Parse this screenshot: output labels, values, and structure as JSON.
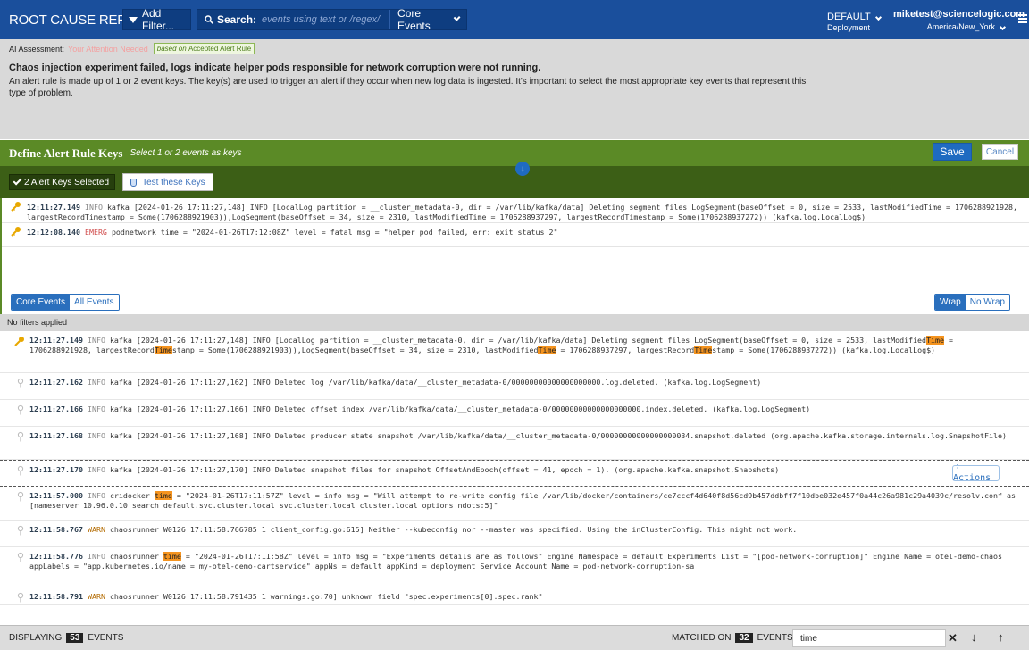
{
  "topbar": {
    "title": "ROOT CAUSE REPORT",
    "add_filter": "Add Filter...",
    "search_label": "Search:",
    "search_placeholder": "events using text or /regex/",
    "scope": "Core Events",
    "deployment_name": "DEFAULT",
    "deployment_label": "Deployment",
    "user_email": "miketest@sciencelogic.com",
    "timezone": "America/New_York"
  },
  "ai": {
    "label": "AI Assessment:",
    "attention": "Your Attention Needed",
    "tag_prefix": "based on",
    "tag_rule": "Accepted Alert Rule",
    "title": "Chaos injection experiment failed, logs indicate helper pods responsible for network corruption were not running.",
    "description": "An alert rule is made up of 1 or 2 event keys. The key(s) are used to trigger an alert if they occur when new log data is ingested. It's important to select the most appropriate key events that represent this type of problem."
  },
  "define": {
    "title": "Define Alert Rule Keys",
    "subtitle": "Select 1 or 2 events as keys",
    "save": "Save",
    "cancel": "Cancel",
    "keys_selected": "2 Alert Keys Selected",
    "test_keys": "Test these Keys"
  },
  "key_events": [
    {
      "ts": "12:11:27.149",
      "level": "INFO",
      "msg": "kafka [2024-01-26 17:11:27,148] INFO [LocalLog partition = __cluster_metadata-0, dir = /var/lib/kafka/data] Deleting segment files LogSegment(baseOffset = 0, size = 2533, lastModifiedTime = 1706288921928, largestRecordTimestamp = Some(1706288921903)),LogSegment(baseOffset = 34, size = 2310, lastModifiedTime = 1706288937297, largestRecordTimestamp = Some(1706288937272)) (kafka.log.LocalLog$)"
    },
    {
      "ts": "12:12:08.140",
      "level": "EMERG",
      "msg": "podnetwork time = \"2024-01-26T17:12:08Z\" level = fatal msg = \"helper pod failed, err: exit status 2\""
    }
  ],
  "tabs": {
    "core": "Core Events",
    "all": "All Events",
    "wrap": "Wrap",
    "nowrap": "No Wrap"
  },
  "filters_text": "No filters applied",
  "events": [
    {
      "ts": "12:11:27.149",
      "level": "INFO",
      "key": true,
      "parts": [
        "kafka [2024-01-26 17:11:27,148] INFO [LocalLog partition = __cluster_metadata-0, dir = /var/lib/kafka/data] Deleting segment files LogSegment(baseOffset = 0, size = 2533, lastModified",
        "Time",
        " = 1706288921928, largestRecord",
        "Time",
        "stamp = Some(1706288921903)),LogSegment(baseOffset = 34, size = 2310, lastModified",
        "Time",
        " = 1706288937297, largestRecord",
        "Time",
        "stamp = Some(1706288937272)) (kafka.log.LocalLog$)"
      ]
    },
    {
      "ts": "12:11:27.162",
      "level": "INFO",
      "parts": [
        "kafka [2024-01-26 17:11:27,162] INFO Deleted log /var/lib/kafka/data/__cluster_metadata-0/00000000000000000000.log.deleted. (kafka.log.LogSegment)"
      ]
    },
    {
      "ts": "12:11:27.166",
      "level": "INFO",
      "parts": [
        "kafka [2024-01-26 17:11:27,166] INFO Deleted offset index /var/lib/kafka/data/__cluster_metadata-0/00000000000000000000.index.deleted. (kafka.log.LogSegment)"
      ]
    },
    {
      "ts": "12:11:27.168",
      "level": "INFO",
      "parts": [
        "kafka [2024-01-26 17:11:27,168] INFO Deleted producer state snapshot /var/lib/kafka/data/__cluster_metadata-0/00000000000000000034.snapshot.deleted (org.apache.kafka.storage.internals.log.SnapshotFile)"
      ]
    },
    {
      "ts": "12:11:27.170",
      "level": "INFO",
      "selected": true,
      "parts": [
        "kafka [2024-01-26 17:11:27,170] INFO Deleted snapshot files for snapshot OffsetAndEpoch(offset = 41, epoch = 1). (org.apache.kafka.snapshot.Snapshots)"
      ]
    },
    {
      "ts": "12:11:57.000",
      "level": "INFO",
      "parts": [
        "cridocker ",
        "time",
        " = \"2024-01-26T17:11:57Z\" level = info msg = \"Will attempt to re-write config file /var/lib/docker/containers/ce7cccf4d640f8d56cd9b457ddbff7f10dbe032e457f0a44c26a981c29a4039c/resolv.conf as [nameserver 10.96.0.10 search default.svc.cluster.local svc.cluster.local cluster.local options ndots:5]\""
      ]
    },
    {
      "ts": "12:11:58.767",
      "level": "WARN",
      "parts": [
        "chaosrunner W0126 17:11:58.766785 1 client_config.go:615] Neither --kubeconfig nor --master was specified. Using the inClusterConfig. This might not work."
      ]
    },
    {
      "ts": "12:11:58.776",
      "level": "INFO",
      "parts": [
        "chaosrunner ",
        "time",
        " = \"2024-01-26T17:11:58Z\" level = info msg = \"Experiments details are as follows\" Engine Namespace = default Experiments List = \"[pod-network-corruption]\" Engine Name = otel-demo-chaos appLabels = \"app.kubernetes.io/name = my-otel-demo-cartservice\" appNs = default appKind = deployment Service Account Name = pod-network-corruption-sa"
      ]
    },
    {
      "ts": "12:11:58.791",
      "level": "WARN",
      "parts": [
        "chaosrunner W0126 17:11:58.791435 1 warnings.go:70] unknown field \"spec.experiments[0].spec.rank\""
      ]
    }
  ],
  "actions_label": "Actions",
  "bottom": {
    "displaying": "DISPLAYING",
    "displaying_count": "53",
    "events_word": "EVENTS",
    "matched_on": "MATCHED ON",
    "matched_count": "32",
    "find_value": "time"
  },
  "colors": {
    "topbar": "#1a4f9c",
    "define_bar": "#5b8a26",
    "keys_bar": "#3c5f16",
    "highlight": "#f5941f",
    "key_icon": "#e8a800"
  }
}
